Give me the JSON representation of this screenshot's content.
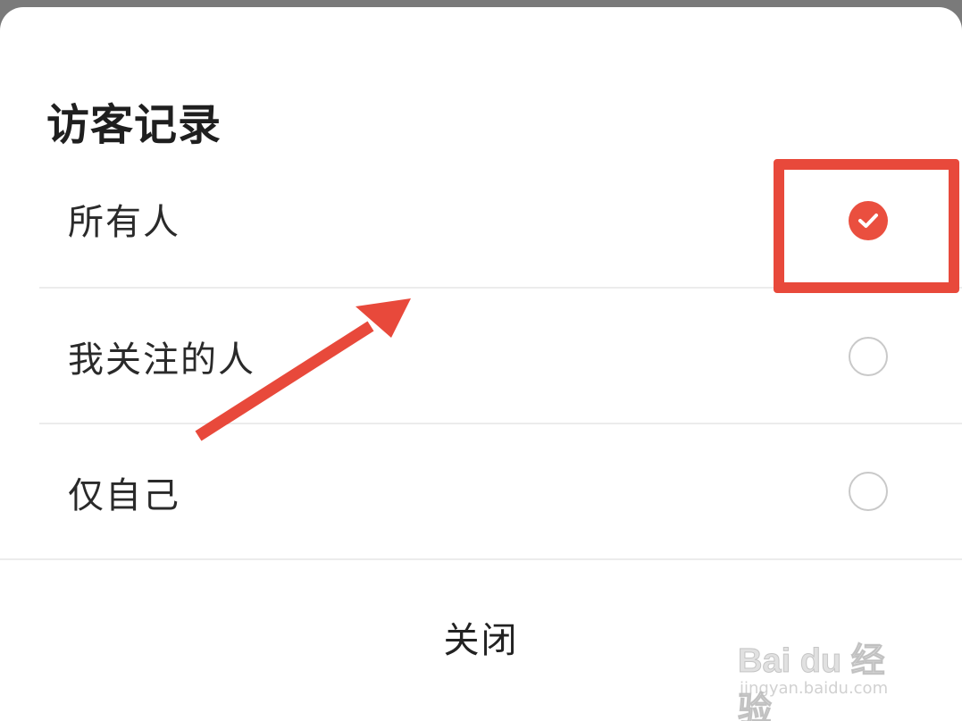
{
  "dialog": {
    "title": "访客记录",
    "options": [
      {
        "label": "所有人",
        "selected": true
      },
      {
        "label": "我关注的人",
        "selected": false
      },
      {
        "label": "仅自己",
        "selected": false
      }
    ],
    "close_label": "关闭"
  },
  "annotation": {
    "highlight_color": "#e8493b",
    "accent_color": "#ea4f3f"
  },
  "watermark": {
    "brand": "Bai du 经验",
    "url": "jingyan.baidu.com"
  },
  "icons": {
    "selected": "check-circle-icon",
    "unselected": "empty-circle-icon"
  }
}
